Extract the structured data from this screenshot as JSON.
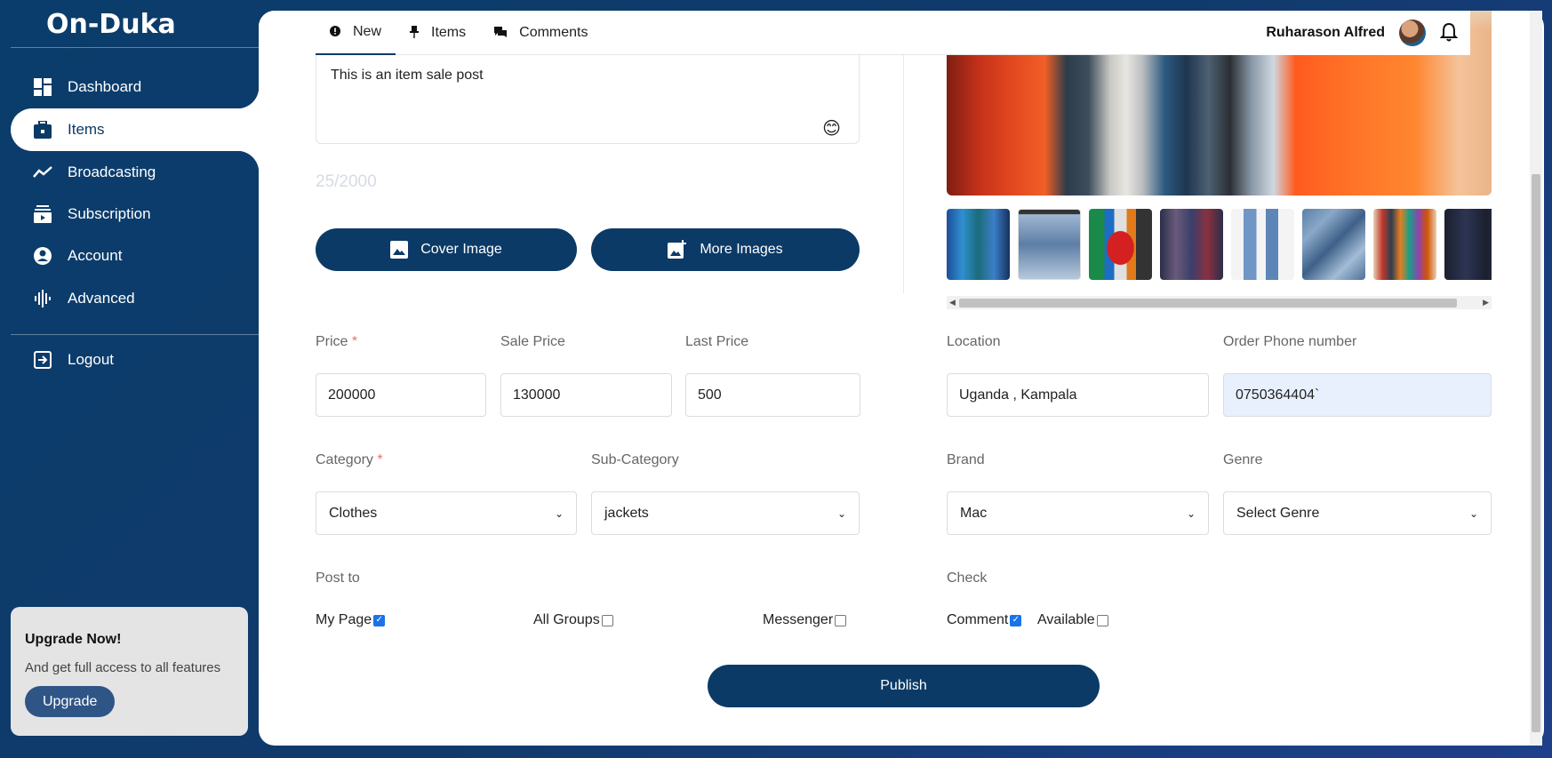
{
  "app": {
    "logo": "On-Duka"
  },
  "sidebar": {
    "items": [
      {
        "label": "Dashboard",
        "icon": "dashboard-icon"
      },
      {
        "label": "Items",
        "icon": "briefcase-icon",
        "active": true
      },
      {
        "label": "Broadcasting",
        "icon": "trend-line-icon"
      },
      {
        "label": "Subscription",
        "icon": "subscription-icon"
      },
      {
        "label": "Account",
        "icon": "account-circle-icon"
      },
      {
        "label": "Advanced",
        "icon": "soundwave-icon"
      }
    ],
    "logout": "Logout",
    "upgrade": {
      "title": "Upgrade Now!",
      "subtitle": "And get full access to all features",
      "button": "Upgrade"
    }
  },
  "header": {
    "tabs": [
      {
        "label": "New",
        "icon": "info-icon",
        "active": true
      },
      {
        "label": "Items",
        "icon": "pin-icon"
      },
      {
        "label": "Comments",
        "icon": "comments-icon"
      }
    ],
    "user_name": "Ruharason Alfred"
  },
  "post": {
    "text": "This is an item sale post",
    "char_count": "25/2000",
    "cover_button": "Cover Image",
    "more_button": "More Images"
  },
  "form": {
    "price_label": "Price",
    "price": "200000",
    "sale_price_label": "Sale Price",
    "sale_price": "130000",
    "last_price_label": "Last Price",
    "last_price": "500",
    "location_label": "Location",
    "location": "Uganda , Kampala",
    "phone_label": "Order Phone number",
    "phone": "0750364404`",
    "category_label": "Category",
    "category": "Clothes",
    "subcategory_label": "Sub-Category",
    "subcategory": "jackets",
    "brand_label": "Brand",
    "brand": "Mac",
    "genre_label": "Genre",
    "genre": "Select Genre",
    "required_mark": "*"
  },
  "post_to": {
    "label": "Post to",
    "options": [
      {
        "label": "My Page",
        "checked": true
      },
      {
        "label": "All Groups",
        "checked": false
      },
      {
        "label": "Messenger",
        "checked": false
      }
    ]
  },
  "check": {
    "label": "Check",
    "options": [
      {
        "label": "Comment",
        "checked": true
      },
      {
        "label": "Available",
        "checked": false
      }
    ]
  },
  "publish_button": "Publish",
  "colors": {
    "primary": "#0b3a66",
    "sidebar_bg": "#0a3d6b",
    "upgrade_button": "#2f5586",
    "checkbox_checked": "#1a73e8"
  }
}
